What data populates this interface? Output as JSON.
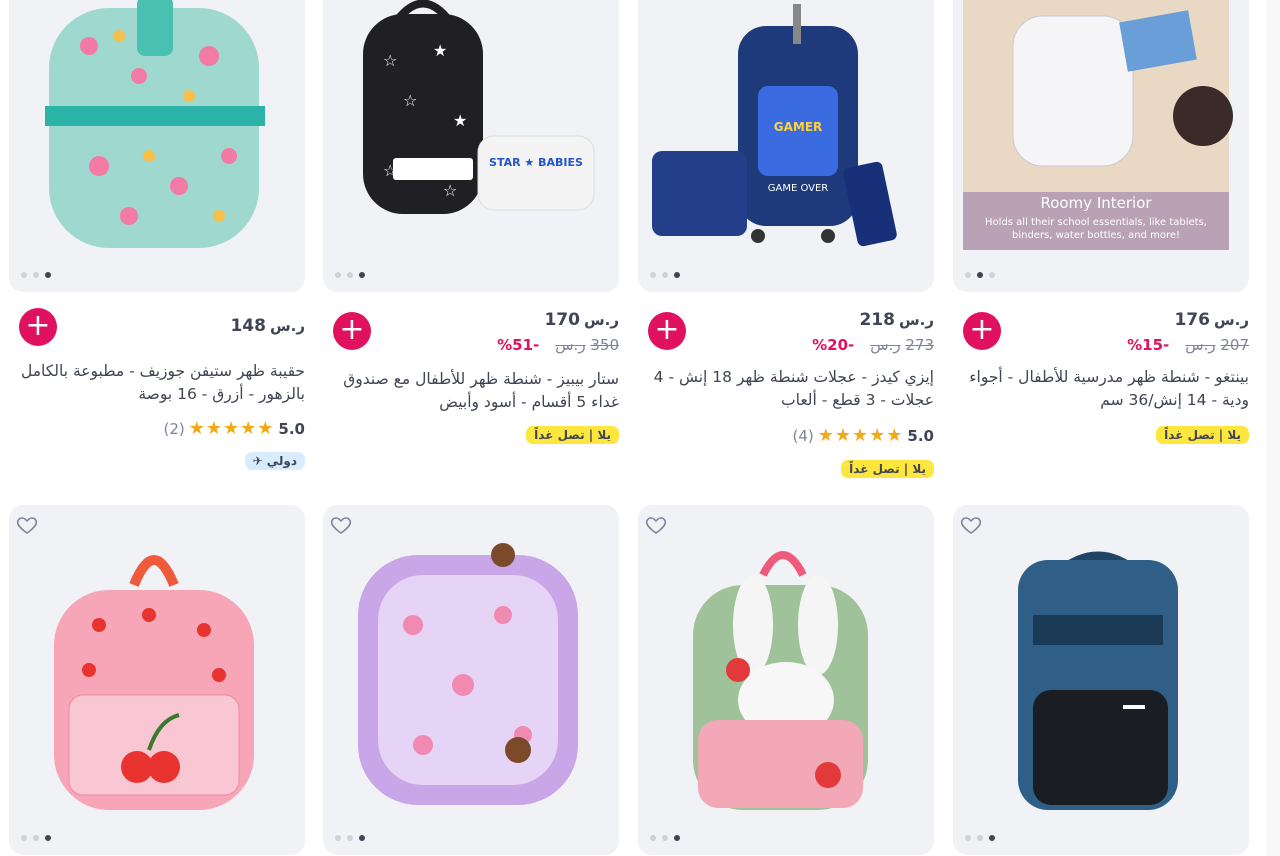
{
  "row1": [
    {
      "price": "148",
      "currency": "ر.س",
      "old_price": "",
      "discount": "",
      "title": "حقيبة ظهر ستيفن جوزيف - مطبوعة بالكامل بالزهور - أزرق - 16 بوصة",
      "rating": "5.0",
      "reviews": "(2)",
      "badge": "",
      "intl": "دولي"
    },
    {
      "price": "170",
      "currency": "ر.س",
      "old_price": "350",
      "discount": "-51%",
      "title": "ستار بيبيز - شنطة ظهر للأطفال مع صندوق غداء 5 أقسام - أسود وأبيض",
      "rating": "",
      "reviews": "",
      "badge": "يلا | تصل غداً",
      "intl": ""
    },
    {
      "price": "218",
      "currency": "ر.س",
      "old_price": "273",
      "discount": "-20%",
      "title": "إيزي كيدز - عجلات شنطة ظهر 18 إنش - 4 عجلات - 3 قطع - ألعاب",
      "rating": "5.0",
      "reviews": "(4)",
      "badge": "يلا | تصل غداً",
      "intl": ""
    },
    {
      "price": "176",
      "currency": "ر.س",
      "old_price": "207",
      "discount": "-15%",
      "title": "بينتغو - شنطة ظهر مدرسية للأطفال - أجواء ودية - 14 إنش/36 سم",
      "rating": "",
      "reviews": "",
      "badge": "يلا | تصل غداً",
      "intl": "",
      "image_heading": "Roomy Interior",
      "image_caption": "Holds all their school essentials, like tablets, binders, water bottles, and more!"
    }
  ],
  "product_images": {
    "card1": "floral-backpack",
    "card2": "star-babies-backpack-lunchbox",
    "card3": "gamer-trolley-set",
    "card4": "roomy-interior-photo",
    "card5": "cherry-backpack",
    "card6": "princess-backpack",
    "card7": "bunny-backpack",
    "card8": "navy-laptop-backpack"
  },
  "colors": {
    "accent": "#e0115f",
    "badge_yellow": "#fde73f",
    "intl_blue": "#d8ecff",
    "star": "#f3a916",
    "card_bg": "#f1f2f6"
  }
}
